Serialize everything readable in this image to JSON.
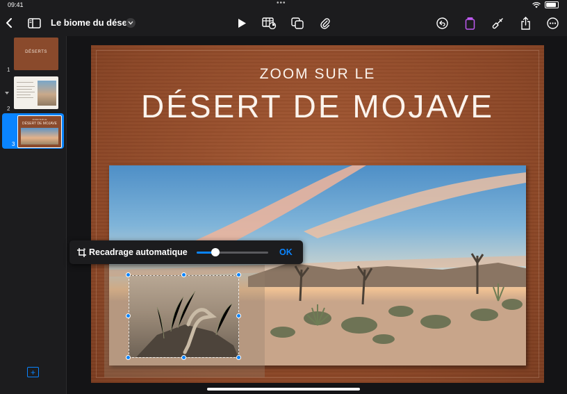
{
  "status_bar": {
    "time": "09:41"
  },
  "toolbar": {
    "doc_title": "Le biome du désert",
    "accent": "#0a84ff",
    "highlight": "#bf5af2"
  },
  "sidebar": {
    "slides": [
      {
        "number": "1",
        "caption": "DÉSERTS"
      },
      {
        "number": "2"
      },
      {
        "number": "3",
        "small": "ZOOM SUR LE",
        "caption": "DÉSERT DE MOJAVE"
      }
    ]
  },
  "slide": {
    "subtitle": "ZOOM SUR LE",
    "title": "DÉSERT DE MOJAVE"
  },
  "autocrop": {
    "label": "Recadrage automatique",
    "ok": "OK",
    "slider_level": 0.26
  }
}
